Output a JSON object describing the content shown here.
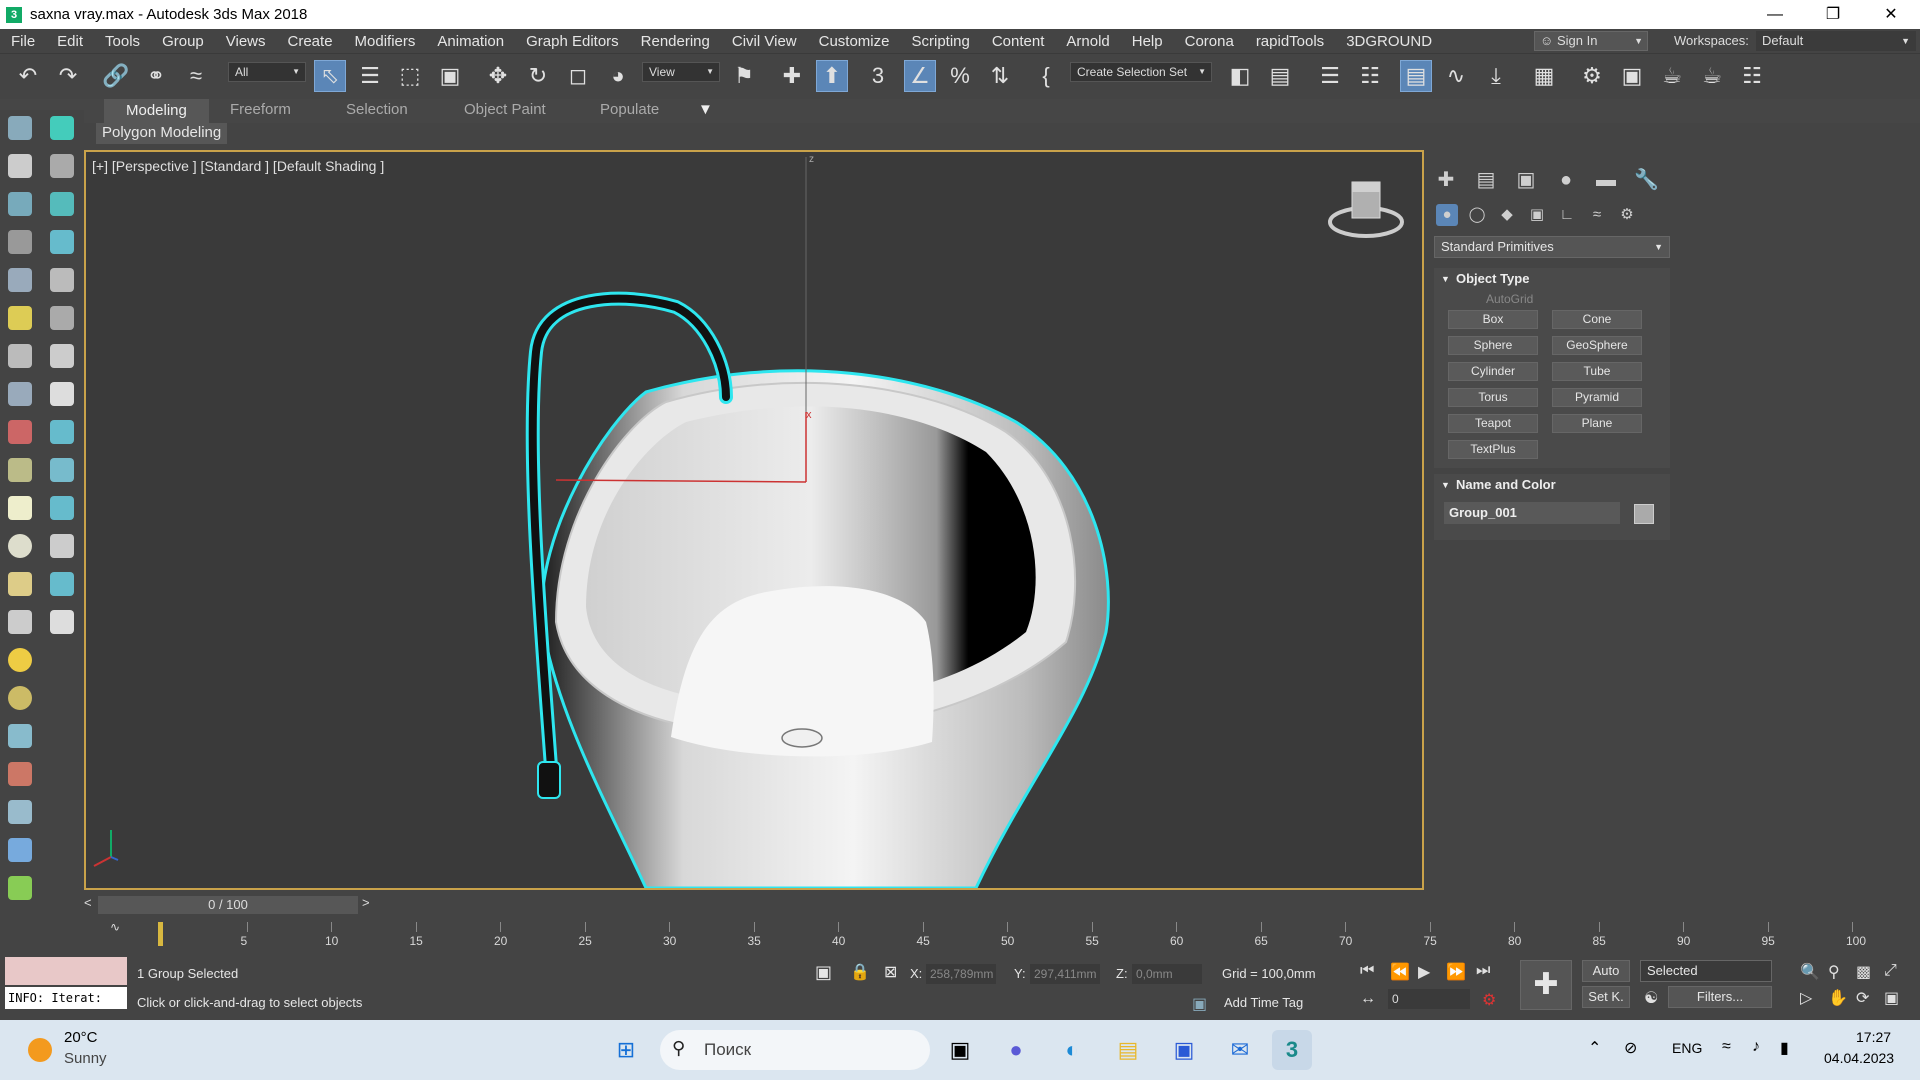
{
  "window": {
    "title": "saxna vray.max - Autodesk 3ds Max 2018",
    "app_icon": "3ds-max-icon",
    "min_glyph": "—",
    "max_glyph": "❐",
    "close_glyph": "✕"
  },
  "menubar": {
    "items": [
      "File",
      "Edit",
      "Tools",
      "Group",
      "Views",
      "Create",
      "Modifiers",
      "Animation",
      "Graph Editors",
      "Rendering",
      "Civil View",
      "Customize",
      "Scripting",
      "Content",
      "Arnold",
      "Help",
      "Corona",
      "rapidTools",
      "3DGROUND"
    ],
    "sign_in": "Sign In",
    "workspaces_label": "Workspaces:",
    "workspace_value": "Default"
  },
  "toolbar": {
    "selection_filter": "All",
    "ref_coord": "View",
    "selection_set": "Create Selection Set"
  },
  "ribbon": {
    "tabs": [
      "Modeling",
      "Freeform",
      "Selection",
      "Object Paint",
      "Populate"
    ],
    "active_tab": "Modeling",
    "panel_label": "Polygon Modeling"
  },
  "viewport": {
    "label": "[+] [Perspective ] [Standard ] [Default Shading ]",
    "selection_color": "#2ee6ef",
    "border_color": "#c9a24a",
    "axis_z": "z",
    "axis_x": "x"
  },
  "command_panel": {
    "category": "Standard Primitives",
    "object_type_title": "Object Type",
    "autogrid": "AutoGrid",
    "primitives": [
      "Box",
      "Cone",
      "Sphere",
      "GeoSphere",
      "Cylinder",
      "Tube",
      "Torus",
      "Pyramid",
      "Teapot",
      "Plane",
      "TextPlus"
    ],
    "name_color_title": "Name and Color",
    "object_name": "Group_001",
    "object_color": "#aaaaaa"
  },
  "timeline": {
    "frame_display": "0 / 100",
    "prev": "<",
    "next": ">",
    "ticks": [
      "5",
      "10",
      "15",
      "20",
      "25",
      "30",
      "35",
      "40",
      "45",
      "50",
      "55",
      "60",
      "65",
      "70",
      "75",
      "80",
      "85",
      "90",
      "95",
      "100"
    ]
  },
  "status": {
    "maxscript_output": "INFO: Iterat:",
    "selection_info": "1 Group Selected",
    "prompt": "Click or click-and-drag to select objects",
    "x_label": "X:",
    "x_value": "258,789mm",
    "y_label": "Y:",
    "y_value": "297,411mm",
    "z_label": "Z:",
    "z_value": "0,0mm",
    "grid": "Grid = 100,0mm",
    "add_time_tag": "Add Time Tag",
    "auto_key": "Auto",
    "set_key": "Set K.",
    "key_filter": "Selected",
    "filters": "Filters...",
    "current_frame": "0"
  },
  "taskbar": {
    "weather_temp": "20°C",
    "weather_desc": "Sunny",
    "search_placeholder": "Поиск",
    "language": "ENG",
    "time": "17:27",
    "date": "04.04.2023"
  }
}
